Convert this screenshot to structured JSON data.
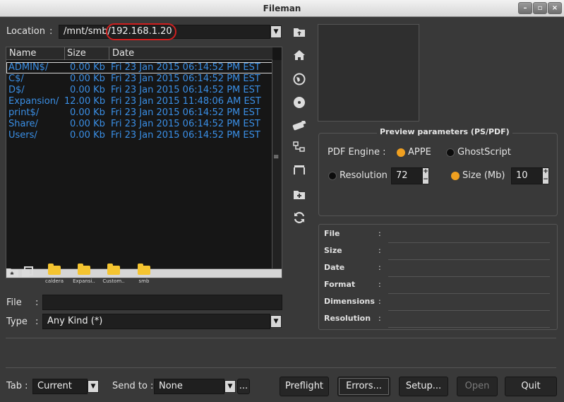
{
  "window": {
    "title": "Fileman",
    "min_label": "–",
    "max_label": "▫",
    "close_label": "×"
  },
  "location": {
    "label": "Location",
    "sep": ":",
    "path_prefix": "/mnt/smb/",
    "path_host": "192.168.1.20"
  },
  "file_list": {
    "headers": [
      "Name",
      "Size",
      "Date"
    ],
    "rows": [
      {
        "name": "ADMIN$/",
        "size": "0.00 Kb",
        "date": "Fri 23 Jan 2015 06:14:52 PM EST"
      },
      {
        "name": "C$/",
        "size": "0.00 Kb",
        "date": "Fri 23 Jan 2015 06:14:52 PM EST"
      },
      {
        "name": "D$/",
        "size": "0.00 Kb",
        "date": "Fri 23 Jan 2015 06:14:52 PM EST"
      },
      {
        "name": "Expansion/",
        "size": "12.00 Kb",
        "date": "Fri 23 Jan 2015 11:48:06 AM EST"
      },
      {
        "name": "print$/",
        "size": "0.00 Kb",
        "date": "Fri 23 Jan 2015 06:14:52 PM EST"
      },
      {
        "name": "Share/",
        "size": "0.00 Kb",
        "date": "Fri 23 Jan 2015 06:14:52 PM EST"
      },
      {
        "name": "Users/",
        "size": "0.00 Kb",
        "date": "Fri 23 Jan 2015 06:14:52 PM EST"
      }
    ],
    "vscroll_grip": "≡",
    "hscroll_grip": "III"
  },
  "bookmarks": [
    {
      "name": "caldera"
    },
    {
      "name": "Expansi.."
    },
    {
      "name": "Custom.."
    },
    {
      "name": "smb"
    }
  ],
  "file_field": {
    "label": "File",
    "sep": ":",
    "value": ""
  },
  "type_field": {
    "label": "Type",
    "sep": ":",
    "value": "Any Kind (*)"
  },
  "preview_params": {
    "title": "Preview parameters (PS/PDF)",
    "pdf_engine_label": "PDF Engine :",
    "engine_appe": "APPE",
    "engine_ghostscript": "GhostScript",
    "resolution_label": "Resolution",
    "resolution_value": "72",
    "size_label": "Size (Mb)",
    "size_value": "10",
    "spin_up": "+",
    "spin_down": "−"
  },
  "info": {
    "rows": [
      "File",
      "Size",
      "Date",
      "Format",
      "Dimensions",
      "Resolution"
    ],
    "sep": ":"
  },
  "bottom": {
    "tab_label": "Tab :",
    "tab_value": "Current",
    "sendto_label": "Send to :",
    "sendto_value": "None",
    "sendto_more": "...",
    "preflight": "Preflight",
    "errors": "Errors...",
    "setup": "Setup...",
    "open": "Open",
    "quit": "Quit"
  },
  "colors": {
    "accent": "#f0a020",
    "list_text": "#3a8fe6",
    "annotation": "#d02020"
  }
}
